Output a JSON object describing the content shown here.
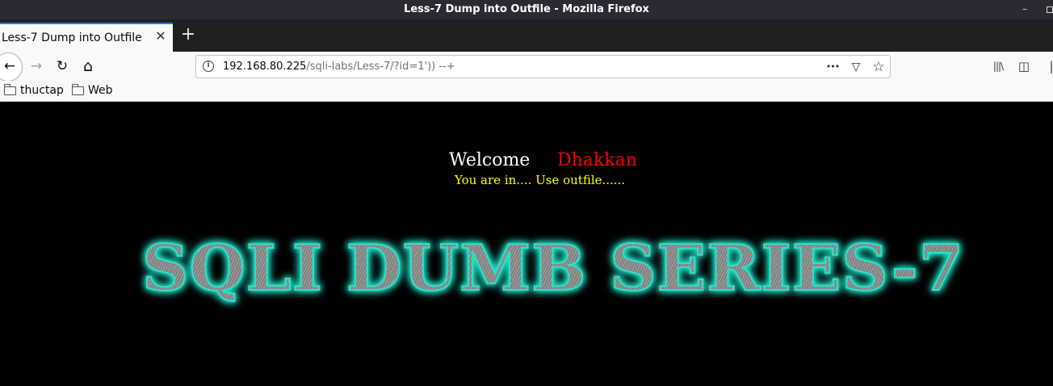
{
  "window": {
    "title": "Less-7 Dump into Outfile - Mozilla Firefox",
    "minimize_label": "–"
  },
  "tabs": [
    {
      "label": "Less-7 Dump into Outfile",
      "close": "✕"
    }
  ],
  "newtab_label": "+",
  "nav": {
    "back": "←",
    "forward": "→",
    "reload": "↻",
    "home": "⌂"
  },
  "url": {
    "host": "192.168.80.225",
    "path": "/sqli-labs/Less-7/?id=1')) --+",
    "info_icon": "i",
    "more": "•••",
    "pocket": "▽",
    "star": "☆"
  },
  "toolbar_right": {
    "library": "|||\\",
    "sidebar": "◫",
    "overflow": "|"
  },
  "bookmarks": [
    {
      "label": "thuctap"
    },
    {
      "label": "Web"
    }
  ],
  "page": {
    "welcome": "Welcome",
    "user": "Dhakkan",
    "message": "You are in.... Use outfile......",
    "banner": "SQLI DUMB SERIES-7"
  },
  "colors": {
    "welcome": "#ffffff",
    "user": "#ff0000",
    "message": "#ffff00",
    "banner_glow": "#1ee6c8"
  },
  "icons": [
    "info-icon",
    "more-icon",
    "pocket-icon",
    "star-icon",
    "library-icon",
    "sidebar-icon",
    "folder-icon",
    "back-icon",
    "forward-icon",
    "reload-icon",
    "home-icon",
    "close-icon",
    "plus-icon"
  ]
}
